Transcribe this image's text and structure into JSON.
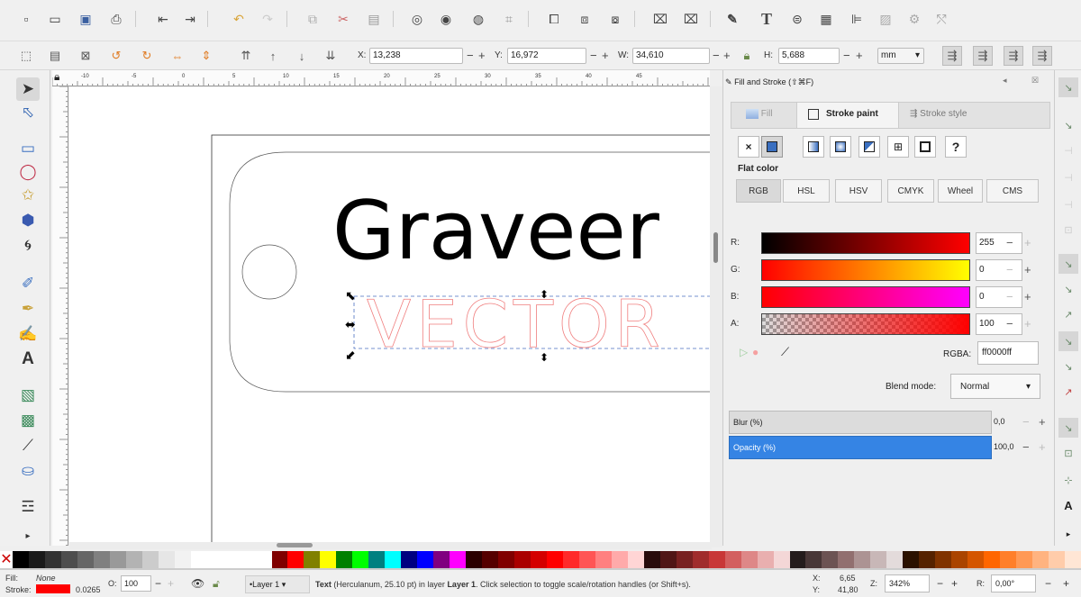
{
  "toolbar": {
    "x_label": "X:",
    "x_value": "13,238",
    "y_label": "Y:",
    "y_value": "16,972",
    "w_label": "W:",
    "w_value": "34,610",
    "h_label": "H:",
    "h_value": "5,688",
    "unit": "mm",
    "minus": "−",
    "plus": "+"
  },
  "ruler": {
    "ticks": [
      "-10",
      "-5",
      "0",
      "5",
      "10",
      "15",
      "20",
      "25",
      "30",
      "35",
      "40",
      "45"
    ]
  },
  "canvas": {
    "title_text": "Graveer",
    "vector_text": "VECTOR"
  },
  "panel": {
    "title": "Fill and Stroke (⇧⌘F)",
    "tabs": {
      "fill": "Fill",
      "stroke_paint": "Stroke paint",
      "stroke_style": "Stroke style"
    },
    "paint_unknown": "?",
    "paint_none": "×",
    "flat_color": "Flat color",
    "color_modes": [
      "RGB",
      "HSL",
      "HSV",
      "CMYK",
      "Wheel",
      "CMS"
    ],
    "channels": [
      {
        "label": "R:",
        "value": "255"
      },
      {
        "label": "G:",
        "value": "0"
      },
      {
        "label": "B:",
        "value": "0"
      },
      {
        "label": "A:",
        "value": "100"
      }
    ],
    "rgba_label": "RGBA:",
    "rgba_value": "ff0000ff",
    "blend_label": "Blend mode:",
    "blend_value": "Normal",
    "blur_label": "Blur (%)",
    "blur_value": "0,0",
    "opacity_label": "Opacity (%)",
    "opacity_value": "100,0"
  },
  "status": {
    "fill_label": "Fill:",
    "fill_value": "None",
    "stroke_label": "Stroke:",
    "stroke_width": "0.0265",
    "opacity_label": "O:",
    "opacity_value": "100",
    "layer": "•Layer 1",
    "message_bold": "Text",
    "message_rest": "(Herculanum, 25.10 pt) in layer",
    "message_layer": "Layer 1",
    "message_tail": ". Click selection to toggle scale/rotation handles (or Shift+s).",
    "x_label": "X:",
    "x_value": "6,65",
    "y_label": "Y:",
    "y_value": "41,80",
    "z_label": "Z:",
    "zoom": "342%",
    "r_label": "R:",
    "rotation": "0,00°"
  },
  "colors": {
    "accent": "#3584e4",
    "stroke_red": "#ff0000"
  }
}
